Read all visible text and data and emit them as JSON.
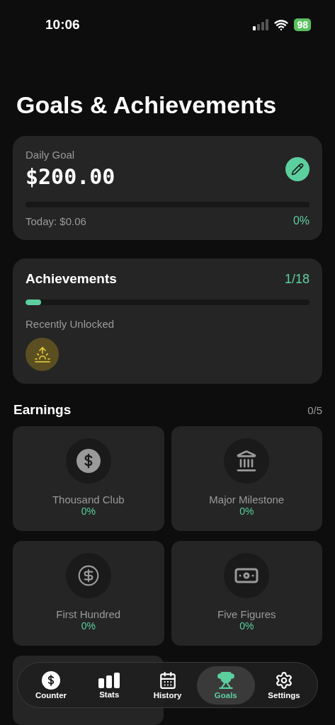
{
  "status_bar": {
    "time": "10:06",
    "battery": "98"
  },
  "title": "Goals & Achievements",
  "daily_goal": {
    "label": "Daily Goal",
    "amount": "$200.00",
    "level": 0,
    "today": "Today: $0.06",
    "percent": "0%"
  },
  "achievements": {
    "title": "Achievements",
    "count": "1/18",
    "level": 0.055,
    "recent_label": "Recently Unlocked"
  },
  "earnings": {
    "title": "Earnings",
    "count": "0/5",
    "items": [
      {
        "name": "Thousand Club",
        "percent": "0%"
      },
      {
        "name": "Major Milestone",
        "percent": "0%"
      },
      {
        "name": "First Hundred",
        "percent": "0%"
      },
      {
        "name": "Five Figures",
        "percent": "0%"
      }
    ]
  },
  "tabs": [
    {
      "label": "Counter",
      "selected": false
    },
    {
      "label": "Stats",
      "selected": false
    },
    {
      "label": "History",
      "selected": false
    },
    {
      "label": "Goals",
      "selected": true
    },
    {
      "label": "Settings",
      "selected": false
    }
  ]
}
